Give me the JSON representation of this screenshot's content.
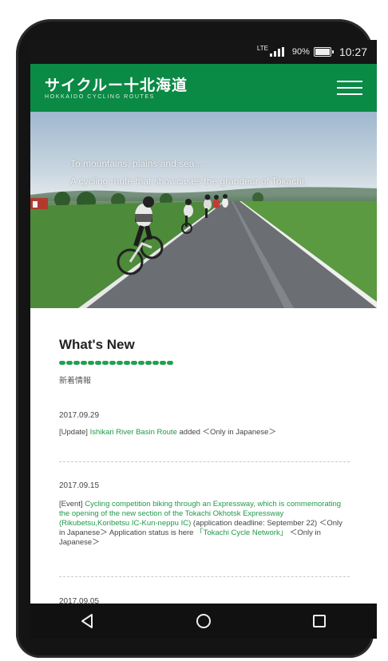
{
  "status_bar": {
    "network": "LTE",
    "battery_percent": "90%",
    "time": "10:27"
  },
  "header": {
    "logo_jp": "サイクルー十北海道",
    "logo_en": "HOKKAIDO CYCLING ROUTES",
    "menu_icon": "hamburger-icon"
  },
  "hero": {
    "tagline_1": "To mountains, plains and sea...",
    "tagline_2": "A cycling route that showcases the grandeur of Tokachi."
  },
  "whats_new": {
    "title": "What's New",
    "subtitle": "新着情報",
    "items": [
      {
        "date": "2017.09.29",
        "prefix": "[Update] ",
        "link": "Ishikari River Basin Route",
        "suffix": " added ＜Only in Japanese＞"
      },
      {
        "date": "2017.09.15",
        "prefix": "[Event] ",
        "link": "Cycling competition biking through an Expressway, which is commemorating the opening of the new section of the Tokachi Okhotsk Expressway (Rikubetsu,Koribetsu IC-Kun-neppu IC)",
        "suffix_1": " (application deadline: September 22) ＜Only in Japanese＞ Application status is here ",
        "link_2": "「Tokachi Cycle Network」",
        "suffix_2": " ＜Only in Japanese＞"
      },
      {
        "date": "2017.09.05"
      }
    ]
  },
  "nav_bar": {
    "back_icon": "back-triangle-icon",
    "home_icon": "home-circle-icon",
    "recents_icon": "recents-square-icon"
  },
  "colors": {
    "brand_green": "#0a8a45",
    "link_green": "#1f9a48",
    "phone_frame": "#141414"
  }
}
